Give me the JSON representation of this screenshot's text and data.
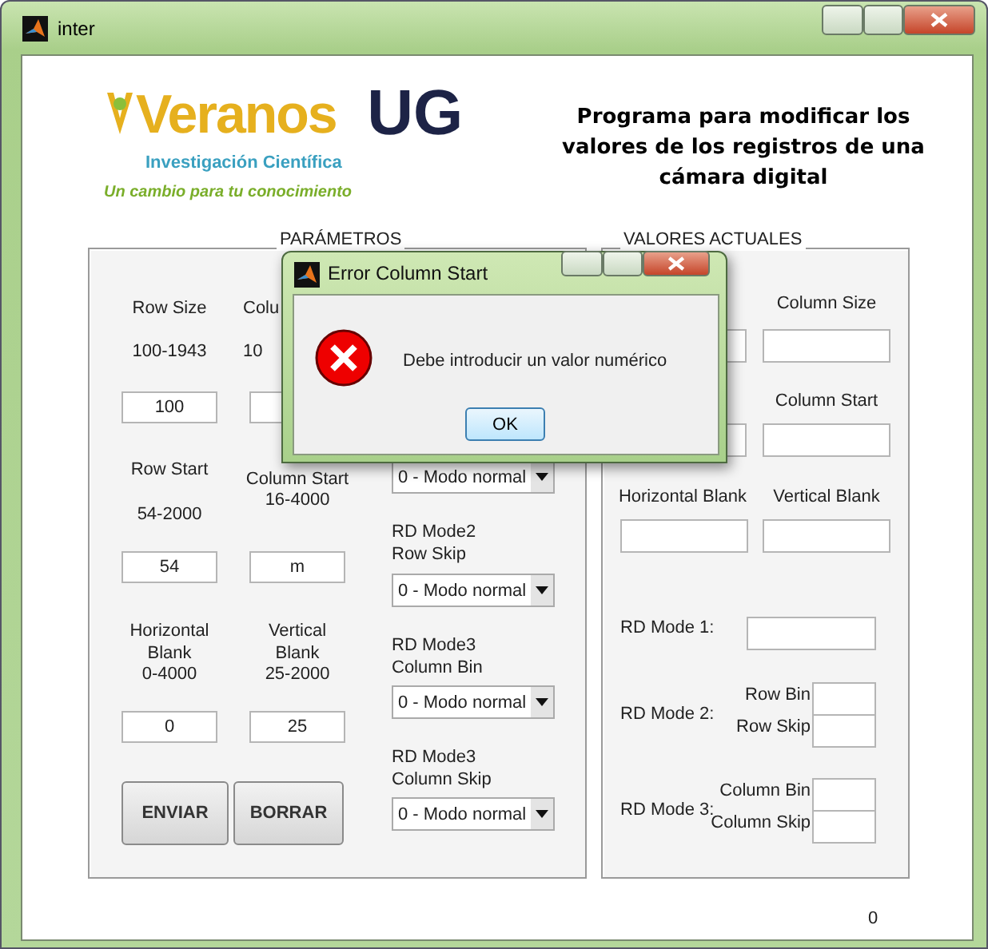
{
  "window": {
    "title": "inter"
  },
  "header": {
    "logo": {
      "word": "Veranos",
      "mark": "UG",
      "subtitle": "Investigación Científica",
      "tagline": "Un cambio para tu conocimiento"
    },
    "title": "Programa para modificar los valores de los registros de una cámara digital"
  },
  "parameters": {
    "title": "PARÁMETROS",
    "fields": [
      {
        "label": "Row Size",
        "range": "100-1943",
        "value": "100"
      },
      {
        "label": "Colu",
        "range": "10"
      },
      {
        "label": "Row Start",
        "range": "54-2000",
        "value": "54"
      },
      {
        "label": "Column Start",
        "range": "16-4000",
        "value": "m"
      },
      {
        "label": "Horizontal Blank",
        "range": "0-4000",
        "value": "0"
      },
      {
        "label": "Vertical Blank",
        "range": "25-2000",
        "value": "25"
      }
    ],
    "modes": [
      {
        "value": "0 - Modo normal"
      },
      {
        "label": "RD Mode2 Row Skip",
        "value": "0 - Modo normal"
      },
      {
        "label": "RD Mode3 Column Bin",
        "value": "0 - Modo normal"
      },
      {
        "label": "RD Mode3 Column Skip",
        "value": "0 - Modo normal"
      }
    ],
    "buttons": [
      "ENVIAR",
      "BORRAR"
    ]
  },
  "current_values": {
    "title": "VALORES ACTUALES",
    "fields": [
      {
        "label": "Column Size"
      },
      {
        "label": "Column Start"
      },
      {
        "label": "Horizontal Blank"
      },
      {
        "label": "Vertical Blank"
      }
    ],
    "modes": [
      {
        "label": "RD Mode 1:"
      },
      {
        "label": "RD Mode 2:",
        "parts": [
          "Row Bin",
          "Row Skip"
        ]
      },
      {
        "label": "RD Mode 3:",
        "parts": [
          "Column Bin",
          "Column Skip"
        ]
      }
    ]
  },
  "counter": "0",
  "dialog": {
    "title": "Error Column Start",
    "message": "Debe introducir un valor numérico",
    "button": "OK"
  }
}
